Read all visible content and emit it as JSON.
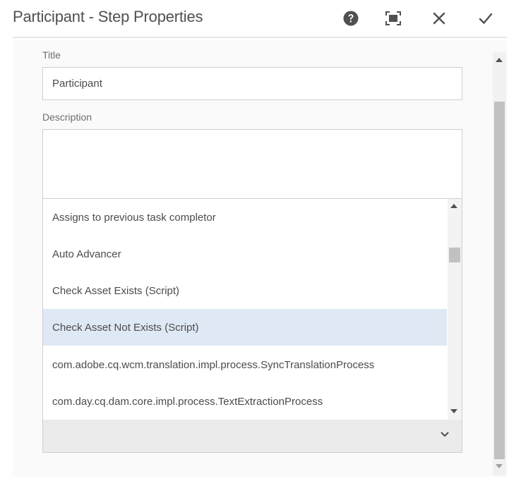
{
  "dialog": {
    "title": "Participant - Step Properties"
  },
  "header_icons": {
    "help": "help-circle-icon",
    "fullscreen": "fullscreen-icon",
    "close": "close-icon",
    "done": "checkmark-icon"
  },
  "form": {
    "title_label": "Title",
    "title_value": "Participant",
    "description_label": "Description",
    "description_value": ""
  },
  "dropdown": {
    "selected_index": 3,
    "options": [
      "Assigns to previous task completor",
      "Auto Advancer",
      "Check Asset Exists (Script)",
      "Check Asset Not Exists (Script)",
      "com.adobe.cq.wcm.translation.impl.process.SyncTranslationProcess",
      "com.day.cq.dam.core.impl.process.TextExtractionProcess"
    ],
    "selected_value": ""
  },
  "colors": {
    "selected_option_bg": "#dfe8f5",
    "icon": "#505050"
  }
}
